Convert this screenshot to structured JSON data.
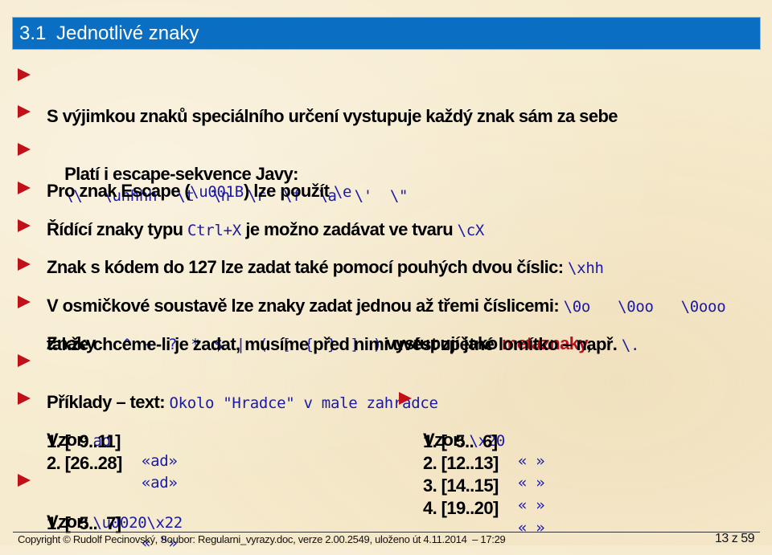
{
  "title": {
    "number": "3.1",
    "text": "Jednotlivé znaky"
  },
  "bullets": {
    "b1": {
      "text": "S výjimkou znaků speciálního určení vystupuje každý znak sám za sebe"
    },
    "b2": {
      "text": "Platí i escape-sekvence Javy:",
      "codes": [
        "\\\\",
        "\\uhhhh",
        "\\t",
        "\\n",
        "\\r",
        "\\f",
        "\\a",
        "\\'",
        "\\\""
      ]
    },
    "b3": {
      "text1": "Pro znak Escape (",
      "code1": "\\u001B",
      "text2": ") lze použít ",
      "code2": "\\e"
    },
    "b4": {
      "text1": "Řídící znaky typu ",
      "code1": "Ctrl+X",
      "text2": " je možno zadávat ve tvaru ",
      "code2": "\\cX"
    },
    "b5": {
      "text1": "Znak s kódem do 127 lze zadat také pomocí pouhých dvou číslic: ",
      "code1": "\\xhh"
    },
    "b6": {
      "text1": "V osmičkové soustavě lze znaky zadat jednou až třemi číslicemi: ",
      "codes": [
        "\\0o",
        "\\0oo",
        "\\0ooo"
      ]
    },
    "b7": {
      "text1": "Znaky ",
      "code1": ". ^ + ? * $ | ( [ { } ] )",
      "text2": " vystupují jako ",
      "highlight": "metaznaky",
      "text3": ",",
      "line2_text": "takže chceme-li je zadat, musíme před nimi uvést zpětné lomítko – např. ",
      "line2_code": "\\."
    },
    "b8": {
      "text1": "Příklady – text: ",
      "code1": "Okolo \"Hradce\" v male zahradce"
    }
  },
  "examples": {
    "ex1": {
      "label": "Vzor: ",
      "pattern": "ad",
      "matches": [
        {
          "range": "1. [  9..11]",
          "match": "«ad»"
        },
        {
          "range": "2. [26..28]",
          "match": "«ad»"
        }
      ]
    },
    "ex2": {
      "label": "Vzor: ",
      "pattern": "\\u0020\\x22",
      "matches": [
        {
          "range": "1. [  5..  7]",
          "match": "« \"»"
        }
      ]
    },
    "ex3": {
      "label": "Vzor: ",
      "pattern": "\\x20",
      "matches": [
        {
          "range": "1. [  5..  6]",
          "match": "« »"
        },
        {
          "range": "2. [12..13]",
          "match": "« »"
        },
        {
          "range": "3. [14..15]",
          "match": "« »"
        },
        {
          "range": "4. [19..20]",
          "match": "« »"
        }
      ]
    }
  },
  "footer": {
    "copyright": "Copyright © Rudolf Pecinovský, Soubor: Regularni_vyrazy.doc, verze 2.00.2549, uloženo út 4.11.2014  – 17:29",
    "page": "13 z 59"
  },
  "colors": {
    "title_bar": "#0a6fc2",
    "bullet": "#c0101a",
    "code": "#1a1aa6",
    "highlight": "#b8101c"
  }
}
